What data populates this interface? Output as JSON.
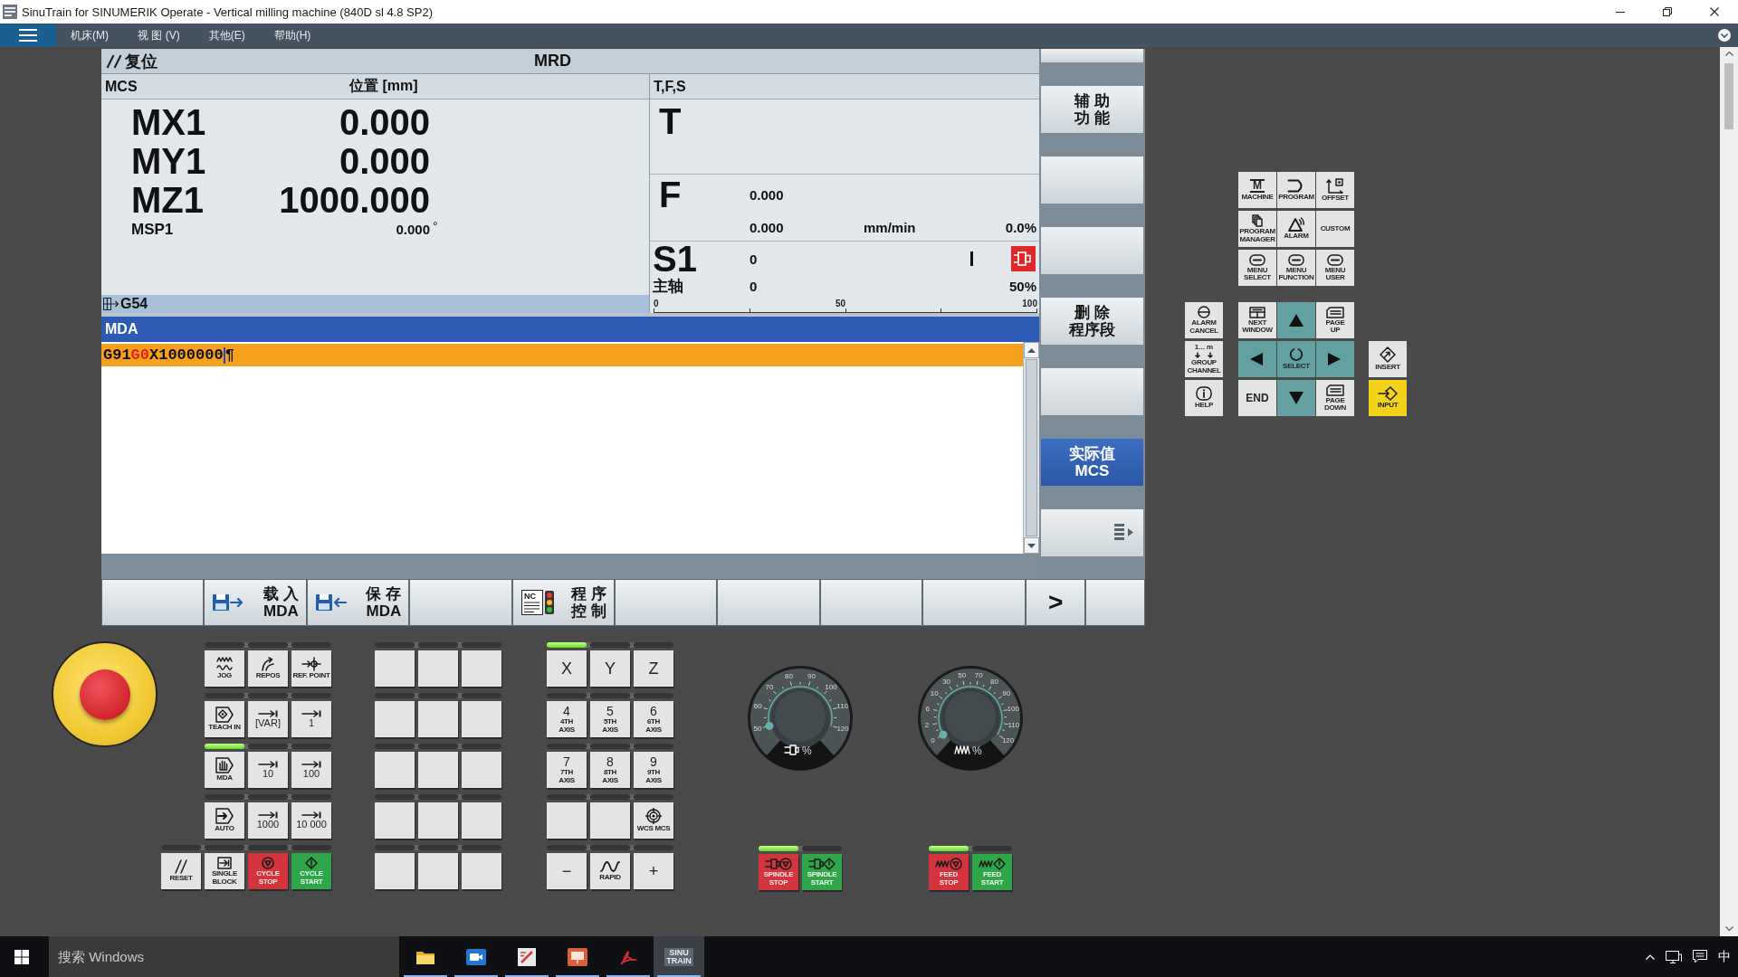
{
  "window": {
    "title": "SinuTrain for SINUMERIK Operate - Vertical milling machine (840D sl 4.8 SP2)"
  },
  "menu": {
    "items": [
      {
        "label": "机床(M)"
      },
      {
        "label": "视 图 (V)"
      },
      {
        "label": "其他(E)"
      },
      {
        "label": "帮助(H)"
      }
    ]
  },
  "hmi": {
    "status": {
      "channel_state": "复位",
      "program": "MRD"
    },
    "position": {
      "frame": "MCS",
      "heading": "位置 [mm]",
      "axes": [
        {
          "kind": "main",
          "name": "MX1",
          "value": "0.000"
        },
        {
          "kind": "main",
          "name": "MY1",
          "value": "0.000"
        },
        {
          "kind": "main",
          "name": "MZ1",
          "value": "1000.000"
        },
        {
          "kind": "spindle",
          "name": "MSP1",
          "value": "0.000",
          "unit": "°"
        }
      ],
      "work_offset": "G54"
    },
    "tfs": {
      "heading": "T,F,S",
      "tool": {
        "label": "T"
      },
      "feed": {
        "label": "F",
        "setpoint": "0.000",
        "actual": "0.000",
        "unit": "mm/min",
        "override": "0.0%"
      },
      "spindle": {
        "label": "S1",
        "speed": "0",
        "stopped": true,
        "name": "主轴",
        "load": "0",
        "override": "50%",
        "scale": [
          "0",
          "50",
          "100"
        ]
      }
    },
    "mda": {
      "title": "MDA",
      "lines": [
        {
          "selected": true,
          "segments": [
            {
              "kind": "code",
              "text": "G91"
            },
            {
              "kind": "motion",
              "text": "G0"
            },
            {
              "kind": "code",
              "text": "X1000000"
            }
          ],
          "end_mark": "¶"
        }
      ]
    },
    "vertical_softkeys": [
      {
        "kind": "blank",
        "selected": false
      },
      {
        "kind": "text",
        "lines": [
          "辅 助",
          "功 能"
        ],
        "selected": false
      },
      {
        "kind": "blank",
        "selected": false
      },
      {
        "kind": "blank",
        "selected": false
      },
      {
        "kind": "text",
        "lines": [
          "删 除",
          "程序段"
        ],
        "selected": false
      },
      {
        "kind": "blank",
        "selected": false
      },
      {
        "kind": "text",
        "lines": [
          "实际值",
          "MCS"
        ],
        "selected": true
      },
      {
        "kind": "more",
        "selected": false
      }
    ],
    "horizontal_softkeys": [
      {
        "kind": "blank"
      },
      {
        "kind": "load",
        "lines": [
          "载 入",
          "MDA"
        ]
      },
      {
        "kind": "save",
        "lines": [
          "保 存",
          "MDA"
        ]
      },
      {
        "kind": "blank"
      },
      {
        "kind": "program",
        "icon_text": "NC",
        "lines": [
          "程 序",
          "控 制"
        ]
      },
      {
        "kind": "blank"
      },
      {
        "kind": "blank"
      },
      {
        "kind": "blank"
      },
      {
        "kind": "blank"
      },
      {
        "kind": "next",
        "lines": [
          ">"
        ]
      },
      {
        "kind": "blank"
      }
    ]
  },
  "operate_keys": {
    "area": [
      [
        {
          "kind": "machine",
          "symbol": "M",
          "lines": [
            "MACHINE"
          ]
        },
        {
          "kind": "program",
          "lines": [
            "PROGRAM"
          ]
        },
        {
          "kind": "offset",
          "lines": [
            "OFFSET"
          ]
        }
      ],
      [
        {
          "kind": "program_manager",
          "lines": [
            "PROGRAM",
            "MANAGER"
          ]
        },
        {
          "kind": "alarm",
          "lines": [
            "ALARM"
          ]
        },
        {
          "kind": "custom",
          "lines": [
            "CUSTOM"
          ]
        }
      ],
      [
        {
          "kind": "menu",
          "lines": [
            "MENU",
            "SELECT"
          ]
        },
        {
          "kind": "menu",
          "lines": [
            "MENU",
            "FUNCTION"
          ]
        },
        {
          "kind": "menu",
          "lines": [
            "MENU",
            "USER"
          ]
        }
      ]
    ],
    "navigation": [
      [
        {
          "kind": "alarm_cancel",
          "lines": [
            "ALARM",
            "CANCEL"
          ]
        },
        {
          "kind": "next_window",
          "lines": [
            "NEXT",
            "WINDOW"
          ]
        },
        {
          "kind": "up"
        },
        {
          "kind": "page_up",
          "lines": [
            "PAGE",
            "UP"
          ]
        }
      ],
      [
        {
          "kind": "group_channel",
          "symbol": "1... m",
          "lines": [
            "GROUP",
            "CHANNEL"
          ]
        },
        {
          "kind": "left"
        },
        {
          "kind": "select",
          "lines": [
            "SELECT"
          ]
        },
        {
          "kind": "right"
        },
        {
          "kind": "insert",
          "lines": [
            "INSERT"
          ]
        }
      ],
      [
        {
          "kind": "help",
          "lines": [
            "HELP"
          ]
        },
        {
          "kind": "end",
          "lines": [
            "END"
          ]
        },
        {
          "kind": "down"
        },
        {
          "kind": "page_down",
          "lines": [
            "PAGE",
            "DOWN"
          ]
        },
        {
          "kind": "input",
          "lines": [
            "INPUT"
          ]
        }
      ]
    ]
  },
  "machine_panel": {
    "mode_keys": [
      [
        {
          "kind": "jog",
          "lines": [
            "JOG"
          ],
          "led": false
        },
        {
          "kind": "repos",
          "lines": [
            "REPOS"
          ],
          "led": false
        },
        {
          "kind": "ref_point",
          "lines": [
            "REF. POINT"
          ],
          "led": false
        }
      ],
      [
        {
          "kind": "teach_in",
          "lines": [
            "TEACH IN"
          ],
          "led": false
        },
        {
          "kind": "increment",
          "lines": [
            "[VAR]"
          ],
          "led": false
        },
        {
          "kind": "increment",
          "lines": [
            "1"
          ],
          "led": false
        }
      ],
      [
        {
          "kind": "mda",
          "lines": [
            "MDA"
          ],
          "led": true
        },
        {
          "kind": "increment",
          "lines": [
            "10"
          ],
          "led": false
        },
        {
          "kind": "increment",
          "lines": [
            "100"
          ],
          "led": false
        }
      ],
      [
        {
          "kind": "auto",
          "lines": [
            "AUTO"
          ],
          "led": false
        },
        {
          "kind": "increment",
          "lines": [
            "1000"
          ],
          "led": false
        },
        {
          "kind": "increment",
          "lines": [
            "10 000"
          ],
          "led": false
        }
      ],
      [
        {
          "kind": "reset",
          "lines": [
            "RESET"
          ],
          "led": false
        },
        {
          "kind": "single_block",
          "lines": [
            "SINGLE",
            "BLOCK"
          ],
          "led": false
        },
        {
          "kind": "cycle_stop",
          "lines": [
            "CYCLE",
            "STOP"
          ],
          "led": false
        },
        {
          "kind": "cycle_start",
          "lines": [
            "CYCLE",
            "START"
          ],
          "led": false
        }
      ]
    ],
    "custom_keys": [
      [
        {
          "kind": "blank",
          "led": false
        },
        {
          "kind": "blank",
          "led": false
        },
        {
          "kind": "blank",
          "led": false
        }
      ],
      [
        {
          "kind": "blank",
          "led": false
        },
        {
          "kind": "blank",
          "led": false
        },
        {
          "kind": "blank",
          "led": false
        }
      ],
      [
        {
          "kind": "blank",
          "led": false
        },
        {
          "kind": "blank",
          "led": false
        },
        {
          "kind": "blank",
          "led": false
        }
      ],
      [
        {
          "kind": "blank",
          "led": false
        },
        {
          "kind": "blank",
          "led": false
        },
        {
          "kind": "blank",
          "led": false
        }
      ],
      [
        {
          "kind": "blank",
          "led": false
        },
        {
          "kind": "blank",
          "led": false
        },
        {
          "kind": "blank",
          "led": false
        }
      ]
    ],
    "axis_keys": [
      [
        {
          "kind": "axis",
          "symbol": "X",
          "led": true
        },
        {
          "kind": "axis",
          "symbol": "Y",
          "led": false
        },
        {
          "kind": "axis",
          "symbol": "Z",
          "led": false
        }
      ],
      [
        {
          "kind": "axis",
          "symbol": "4",
          "lines": [
            "4TH",
            "AXIS"
          ],
          "led": false
        },
        {
          "kind": "axis",
          "symbol": "5",
          "lines": [
            "5TH",
            "AXIS"
          ],
          "led": false
        },
        {
          "kind": "axis",
          "symbol": "6",
          "lines": [
            "6TH",
            "AXIS"
          ],
          "led": false
        }
      ],
      [
        {
          "kind": "axis",
          "symbol": "7",
          "lines": [
            "7TH",
            "AXIS"
          ],
          "led": false
        },
        {
          "kind": "axis",
          "symbol": "8",
          "lines": [
            "8TH",
            "AXIS"
          ],
          "led": false
        },
        {
          "kind": "axis",
          "symbol": "9",
          "lines": [
            "9TH",
            "AXIS"
          ],
          "led": false
        }
      ],
      [
        {
          "kind": "blank",
          "led": false
        },
        {
          "kind": "blank",
          "led": false
        },
        {
          "kind": "wcs_mcs",
          "lines": [
            "WCS MCS"
          ],
          "led": false
        }
      ],
      [
        {
          "kind": "axis",
          "symbol": "−",
          "led": false
        },
        {
          "kind": "rapid",
          "lines": [
            "RAPID"
          ],
          "led": false
        },
        {
          "kind": "axis",
          "symbol": "+",
          "led": false
        }
      ]
    ],
    "overrides": [
      {
        "kind": "spindle",
        "scale": [
          "50",
          "60",
          "70",
          "80",
          "90",
          "100",
          "110",
          "120"
        ],
        "unit": "%",
        "level": 0,
        "keys": [
          {
            "kind": "spindle_stop",
            "lines": [
              "SPINDLE",
              "STOP"
            ],
            "led": true
          },
          {
            "kind": "spindle_start",
            "lines": [
              "SPINDLE",
              "START"
            ],
            "led": false
          }
        ]
      },
      {
        "kind": "feed",
        "scale": [
          "0",
          "2",
          "6",
          "10",
          "30",
          "50",
          "70",
          "80",
          "90",
          "100",
          "110",
          "120"
        ],
        "unit": "%",
        "level": 0,
        "keys": [
          {
            "kind": "feed_stop",
            "lines": [
              "FEED",
              "STOP"
            ],
            "led": true
          },
          {
            "kind": "feed_start",
            "lines": [
              "FEED",
              "START"
            ],
            "led": false
          }
        ]
      }
    ]
  },
  "taskbar": {
    "search": {
      "placeholder": "搜索 Windows"
    },
    "apps": [
      {
        "kind": "folder",
        "running": true,
        "selected": false
      },
      {
        "kind": "camera",
        "running": true,
        "selected": false
      },
      {
        "kind": "pen",
        "running": true,
        "selected": false
      },
      {
        "kind": "slides",
        "running": true,
        "selected": false
      },
      {
        "kind": "pdf",
        "running": true,
        "selected": false
      },
      {
        "kind": "sinutrain",
        "lines": [
          "SINU",
          "TRAIN"
        ],
        "running": true,
        "selected": true
      }
    ],
    "ime": "中"
  }
}
